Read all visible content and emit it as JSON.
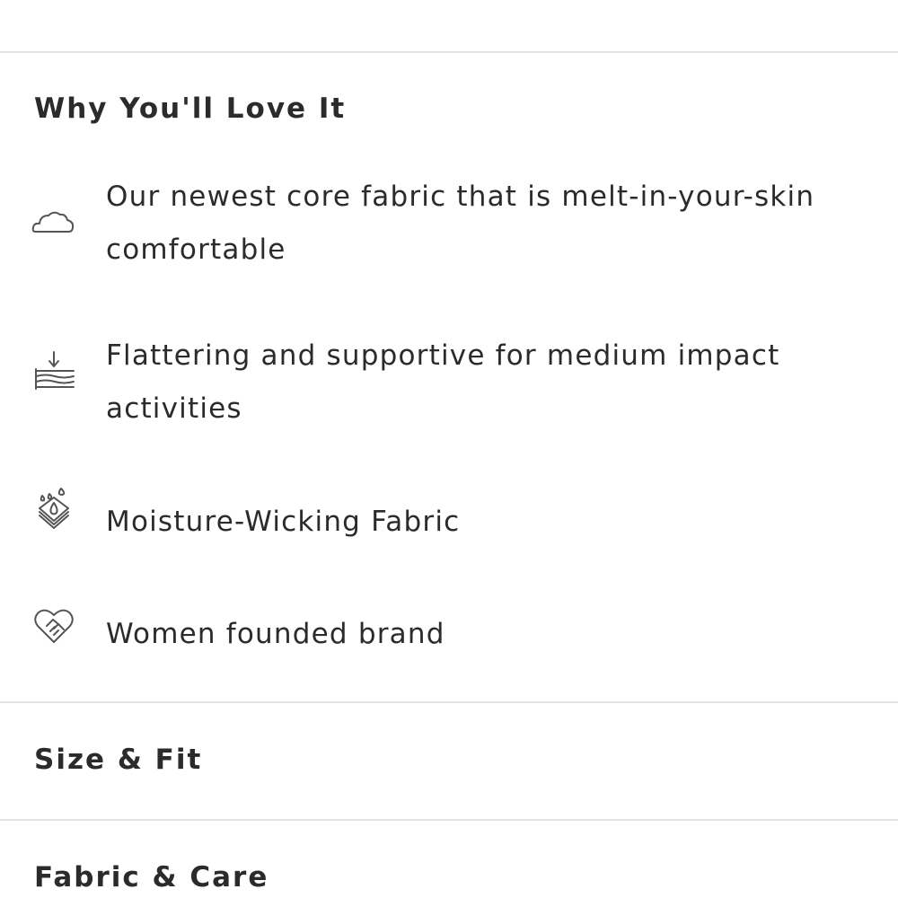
{
  "why_section": {
    "heading": "Why You'll Love It",
    "features": [
      {
        "icon": "cloud-icon",
        "text": "Our newest core fabric that is melt-in-your-skin comfortable"
      },
      {
        "icon": "compression-support-icon",
        "text": "Flattering and supportive for medium impact activities"
      },
      {
        "icon": "moisture-wicking-icon",
        "text": "Moisture-Wicking Fabric"
      },
      {
        "icon": "heart-handshake-icon",
        "text": "Women founded brand"
      }
    ]
  },
  "accordions": [
    {
      "label": "Size & Fit"
    },
    {
      "label": "Fabric & Care"
    }
  ]
}
